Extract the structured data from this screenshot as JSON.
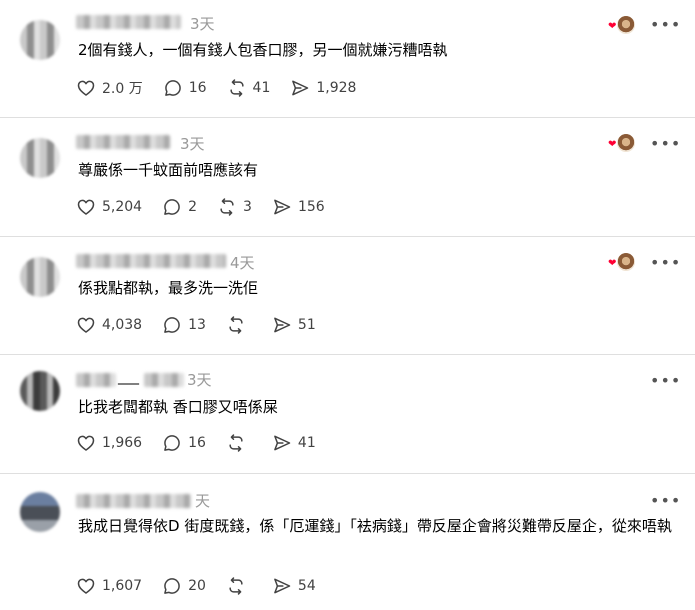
{
  "posts": [
    {
      "time": "3天",
      "text": "2個有錢人，一個有錢人包香口膠，另一個就嫌污糟唔執",
      "likes": "2.0 万",
      "replies": "16",
      "reposts": "41",
      "shares": "1,928",
      "author_liked": true
    },
    {
      "time": "3天",
      "text": "尊嚴係一千蚊面前唔應該有",
      "likes": "5,204",
      "replies": "2",
      "reposts": "3",
      "shares": "156",
      "author_liked": true
    },
    {
      "time": "4天",
      "text": "係我點都執，最多洗一洗佢",
      "likes": "4,038",
      "replies": "13",
      "reposts": "",
      "shares": "51",
      "author_liked": true
    },
    {
      "handle_fragment": "___",
      "time": "3天",
      "text": "比我老闆都執 香口膠又唔係屎",
      "likes": "1,966",
      "replies": "16",
      "reposts": "",
      "shares": "41",
      "author_liked": false
    },
    {
      "time": "天",
      "text": "我成日覺得依D 街度既錢，係「厄運錢」「袪病錢」帶反屋企會將災難帶反屋企，從來唔執",
      "likes": "1,607",
      "replies": "20",
      "reposts": "",
      "shares": "54",
      "author_liked": false
    }
  ],
  "icons": {
    "like": "heart-outline-icon",
    "reply": "speech-bubble-icon",
    "repost": "repost-arrows-icon",
    "share": "paper-plane-icon",
    "more": "more-dots-icon",
    "author_liked": "author-liked-heart-icon"
  },
  "more_glyph": "•••",
  "colors": {
    "text": "#000000",
    "muted": "#999999",
    "icon": "#424242",
    "liked_heart": "#ff0034",
    "divider": "#dfdfdf"
  }
}
